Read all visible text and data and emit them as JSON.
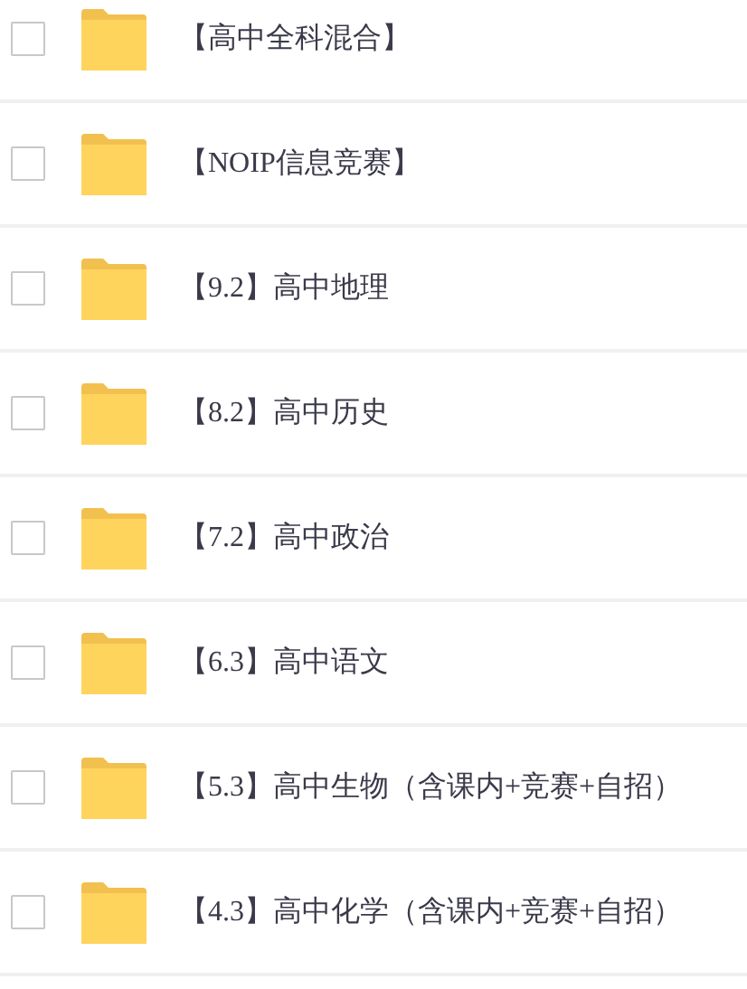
{
  "folders": [
    {
      "name": "【高中全科混合】",
      "checked": false
    },
    {
      "name": "【NOIP信息竞赛】",
      "checked": false
    },
    {
      "name": "【9.2】高中地理",
      "checked": false
    },
    {
      "name": "【8.2】高中历史",
      "checked": false
    },
    {
      "name": "【7.2】高中政治",
      "checked": false
    },
    {
      "name": "【6.3】高中语文",
      "checked": false
    },
    {
      "name": "【5.3】高中生物（含课内+竞赛+自招）",
      "checked": false
    },
    {
      "name": "【4.3】高中化学（含课内+竞赛+自招）",
      "checked": false
    }
  ]
}
